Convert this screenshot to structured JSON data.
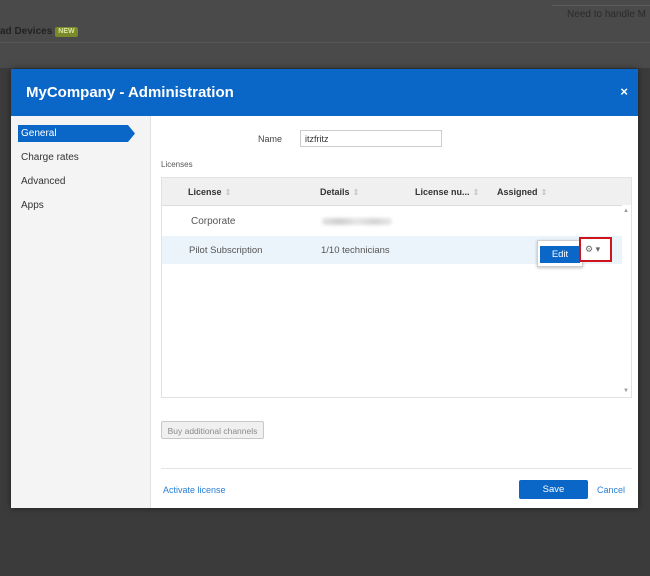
{
  "background": {
    "devices_label": "ad Devices",
    "new_badge": "NEW",
    "help_text": "Need to handle M"
  },
  "modal": {
    "title": "MyCompany - Administration",
    "close_icon": "×",
    "header_color": "#0a67c8"
  },
  "sidebar": {
    "items": [
      {
        "label": "General",
        "active": true
      },
      {
        "label": "Charge rates",
        "active": false
      },
      {
        "label": "Advanced",
        "active": false
      },
      {
        "label": "Apps",
        "active": false
      }
    ]
  },
  "general": {
    "name_label": "Name",
    "name_value": "itzfritz",
    "licenses_label": "Licenses"
  },
  "table": {
    "columns": [
      "License",
      "Details",
      "License nu...",
      "Assigned"
    ],
    "sort_glyph": "⇕",
    "rows": [
      {
        "license": "Corporate",
        "details": "",
        "license_number": "",
        "assigned": ""
      },
      {
        "license": "Pilot Subscription",
        "details": "1/10 technicians",
        "license_number": "",
        "assigned": ""
      }
    ]
  },
  "row_actions": {
    "gear_icon": "⚙",
    "caret": "▾",
    "edit_label": "Edit",
    "highlight_color": "#d0141b"
  },
  "buttons": {
    "buy_label": "Buy additional channels",
    "activate_label": "Activate license",
    "save_label": "Save",
    "cancel_label": "Cancel"
  }
}
